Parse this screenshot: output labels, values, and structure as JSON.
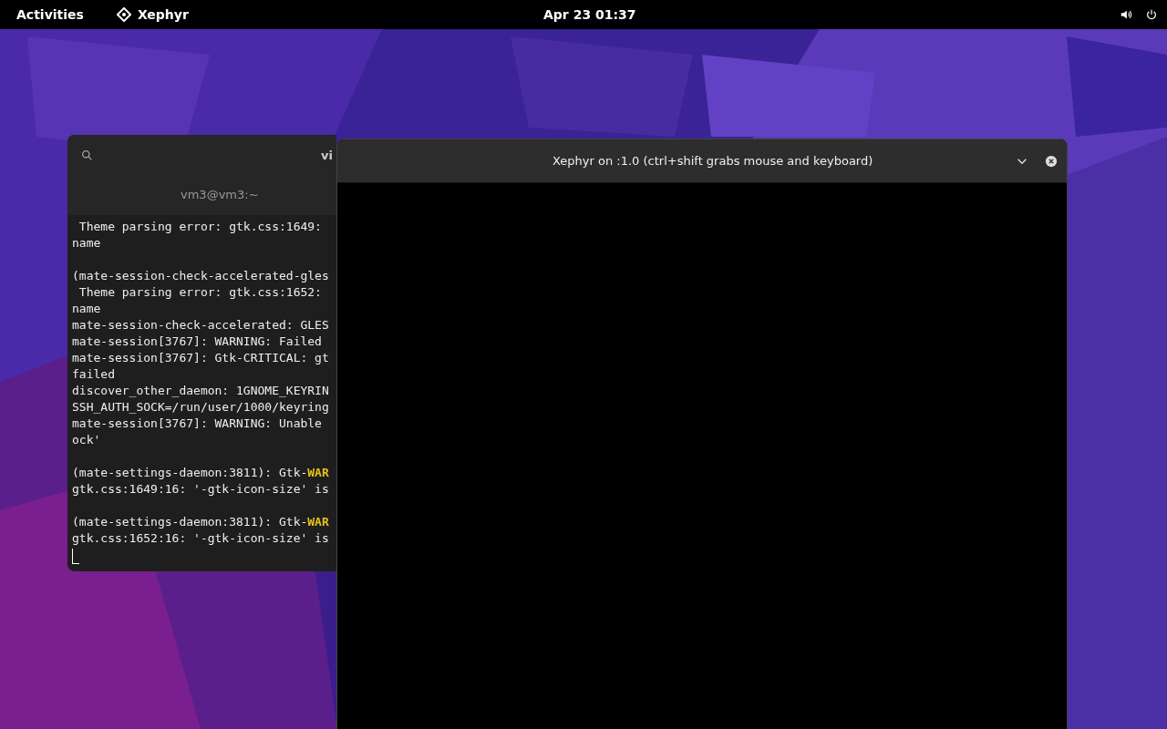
{
  "top_bar": {
    "activities": "Activities",
    "app_name": "Xephyr",
    "clock": "Apr 23  01:37"
  },
  "terminal": {
    "title": "vi",
    "tab_title": "vm3@vm3:~",
    "blocks": [
      [
        " Theme parsing error: gtk.css:1649:",
        "name"
      ],
      [
        "(mate-session-check-accelerated-gles",
        " Theme parsing error: gtk.css:1652:",
        "name",
        "mate-session-check-accelerated: GLES",
        "mate-session[3767]: WARNING: Failed",
        "mate-session[3767]: Gtk-CRITICAL: gt",
        "failed",
        "discover_other_daemon: 1GNOME_KEYRIN",
        "SSH_AUTH_SOCK=/run/user/1000/keyring",
        "mate-session[3767]: WARNING: Unable",
        "ock'"
      ],
      [
        "(mate-settings-daemon:3811): Gtk-**WAR**",
        "gtk.css:1649:16: '-gtk-icon-size' is"
      ],
      [
        "(mate-settings-daemon:3811): Gtk-**WAR**",
        "gtk.css:1652:16: '-gtk-icon-size' is"
      ]
    ]
  },
  "xephyr": {
    "title": "Xephyr on :1.0 (ctrl+shift grabs mouse and keyboard)"
  }
}
